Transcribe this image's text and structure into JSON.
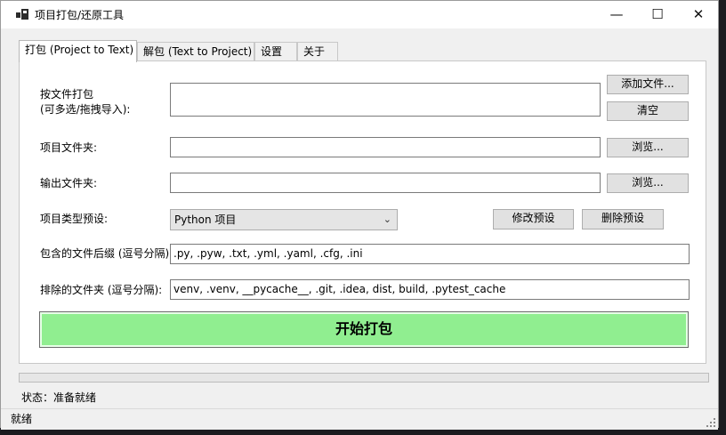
{
  "window": {
    "title": "项目打包/还原工具",
    "minimize_glyph": "—",
    "maximize_glyph": "☐",
    "close_glyph": "✕",
    "icon": "app-window-icon"
  },
  "tabs": [
    {
      "label": "打包 (Project to Text)",
      "active": true
    },
    {
      "label": "解包 (Text to Project)",
      "active": false
    },
    {
      "label": "设置",
      "active": false
    },
    {
      "label": "关于",
      "active": false
    }
  ],
  "pack": {
    "files_label_line1": "按文件打包",
    "files_label_line2": "(可多选/拖拽导入):",
    "files_value": "",
    "add_files_button": "添加文件...",
    "clear_button": "清空",
    "project_folder_label": "项目文件夹:",
    "project_folder_value": "",
    "project_browse_button": "浏览...",
    "output_folder_label": "输出文件夹:",
    "output_folder_value": "",
    "output_browse_button": "浏览...",
    "preset_label": "项目类型预设:",
    "preset_selected": "Python 项目",
    "edit_preset_button": "修改预设",
    "delete_preset_button": "删除预设",
    "include_ext_label": "包含的文件后缀 (逗号分隔)",
    "include_ext_value": ".py, .pyw, .txt, .yml, .yaml, .cfg, .ini",
    "exclude_dirs_label": "排除的文件夹 (逗号分隔):",
    "exclude_dirs_value": "venv, .venv, __pycache__, .git, .idea, dist, build, .pytest_cache",
    "start_button": "开始打包",
    "start_button_color": "#90ee90"
  },
  "progress": {
    "value": 0
  },
  "status": {
    "line": "状态：准备就绪",
    "bar_text": "就绪"
  }
}
